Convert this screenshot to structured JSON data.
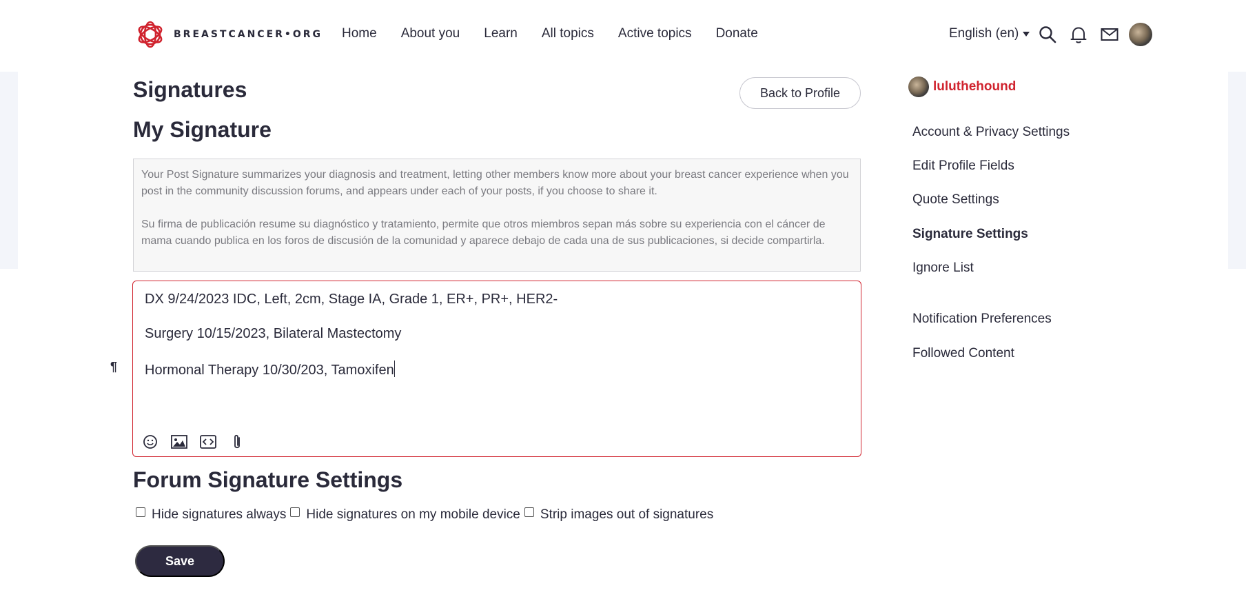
{
  "header": {
    "logo_text": "BREASTCANCER•ORG",
    "nav": [
      "Home",
      "About you",
      "Learn",
      "All topics",
      "Active topics",
      "Donate"
    ],
    "language": "English (en)",
    "brand_color": "#d0232e"
  },
  "main": {
    "page_title": "Signatures",
    "back_button": "Back to Profile",
    "section_title": "My Signature",
    "info_en": "Your Post Signature summarizes your diagnosis and treatment, letting other members know more about your breast cancer experience when you post in the community discussion forums, and appears under each of your posts, if you choose to share it.",
    "info_es": "Su firma de publicación resume su diagnóstico y tratamiento, permite que otros miembros sepan más sobre su experiencia con el cáncer de mama cuando publica en los foros de discusión de la comunidad y aparece debajo de cada una de sus publicaciones, si decide compartirla.",
    "editor_lines": [
      "DX 9/24/2023 IDC, Left, 2cm, Stage IA, Grade 1, ER+, PR+, HER2-",
      "Surgery 10/15/2023, Bilateral Mastectomy",
      "Hormonal Therapy 10/30/203, Tamoxifen"
    ],
    "pilcrow": "¶",
    "toolbar_icons": [
      "emoji-icon",
      "image-icon",
      "code-icon",
      "attachment-icon"
    ],
    "forum_title": "Forum Signature Settings",
    "checkboxes": [
      {
        "label": "Hide signatures always",
        "checked": false
      },
      {
        "label": "Hide signatures on my mobile device",
        "checked": false
      },
      {
        "label": "Strip images out of signatures",
        "checked": false
      }
    ],
    "save_button": "Save"
  },
  "sidebar": {
    "username": "luluthehound",
    "links": [
      "Account & Privacy Settings",
      "Edit Profile Fields",
      "Quote Settings",
      "Signature Settings",
      "Ignore List",
      "Notification Preferences",
      "Followed Content"
    ],
    "active_link": "Signature Settings"
  }
}
